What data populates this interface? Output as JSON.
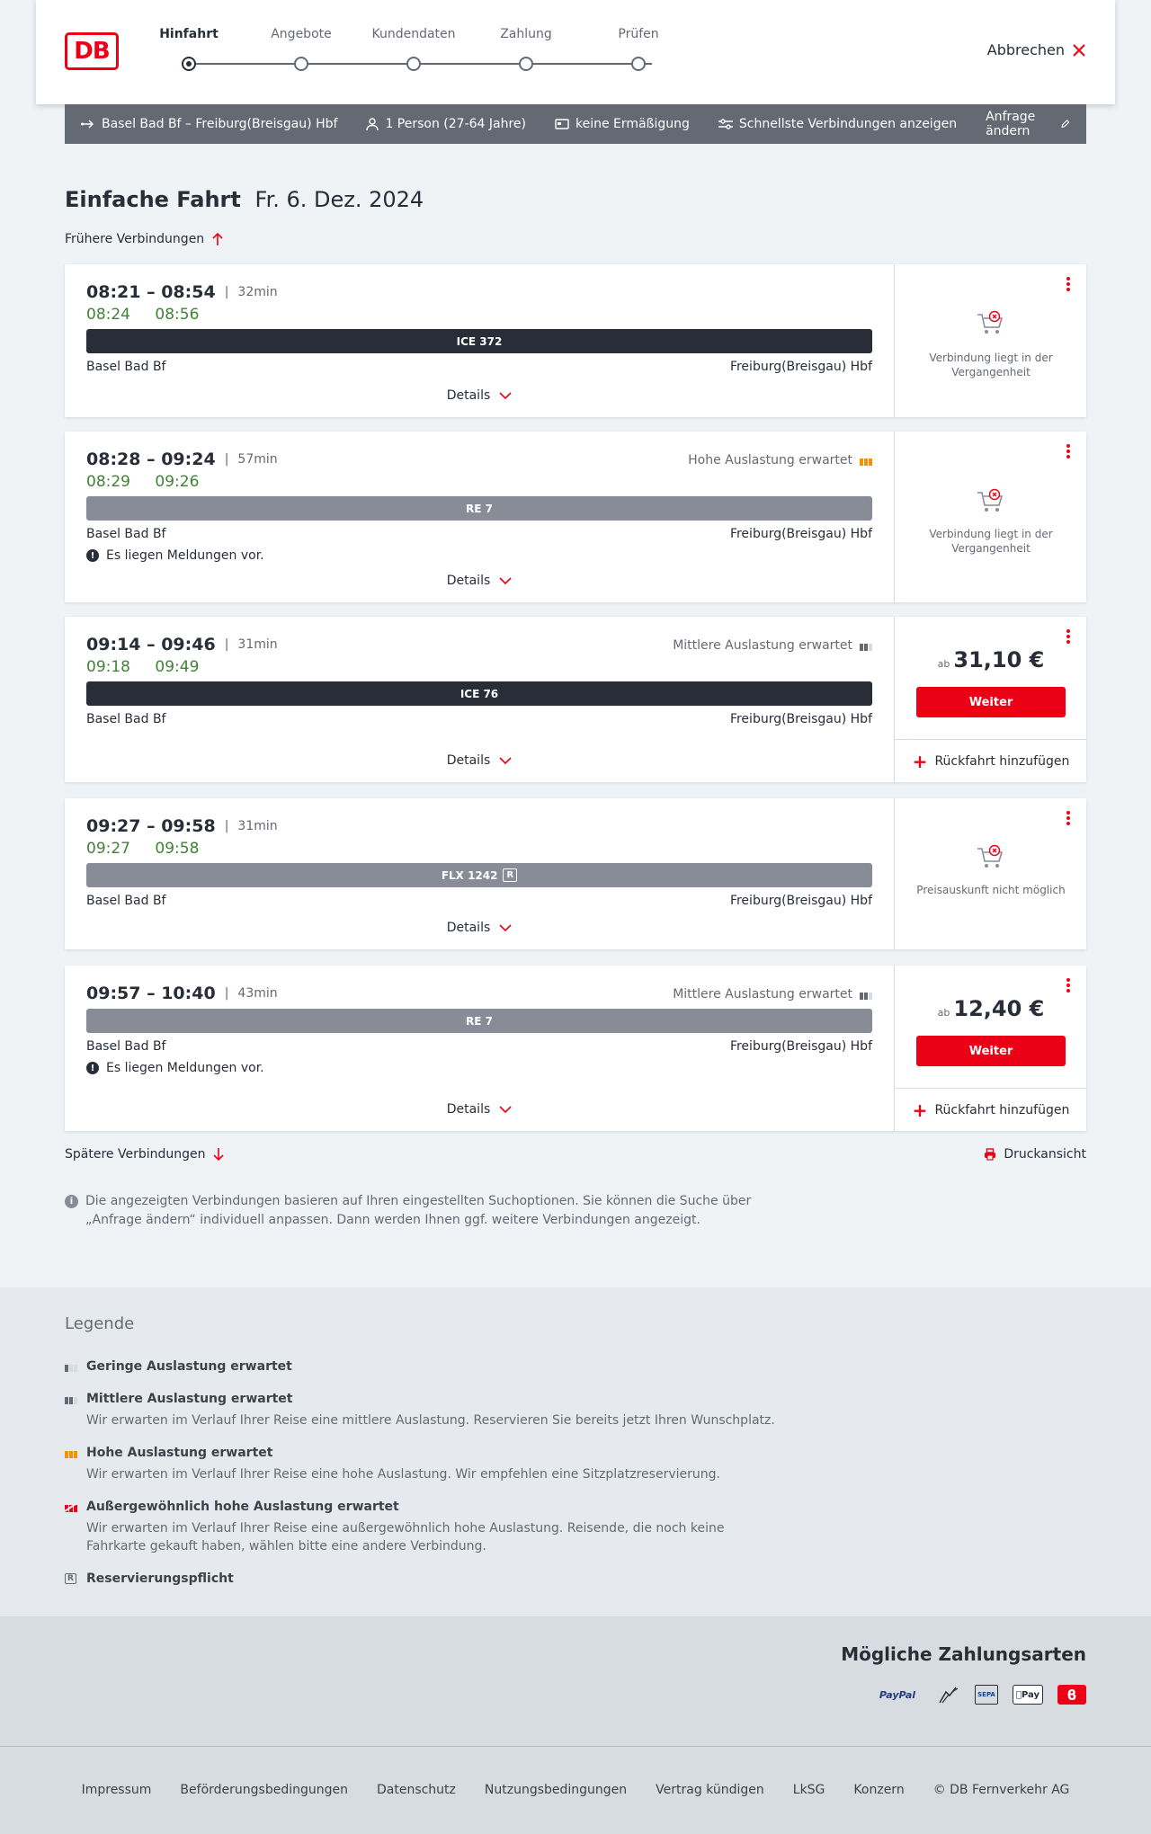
{
  "header": {
    "logo": "DB",
    "steps": [
      "Hinfahrt",
      "Angebote",
      "Kundendaten",
      "Zahlung",
      "Prüfen"
    ],
    "cancel": "Abbrechen"
  },
  "infobar": {
    "route": "Basel Bad Bf – Freiburg(Breisgau) Hbf",
    "persons": "1 Person (27-64 Jahre)",
    "discount": "keine Ermäßigung",
    "fastest": "Schnellste Verbindungen anzeigen",
    "edit": "Anfrage ändern"
  },
  "page": {
    "title": "Einfache Fahrt",
    "date": "Fr. 6. Dez. 2024",
    "earlier": "Frühere Verbindungen",
    "later": "Spätere Verbindungen",
    "print": "Druckansicht",
    "note": "Die angezeigten Verbindungen basieren auf Ihren eingestellten Suchoptionen. Sie können die Suche über „Anfrage ändern“ individuell anpassen. Dann werden Ihnen ggf. weitere Verbindungen angezeigt."
  },
  "connections": [
    {
      "times": "08:21 – 08:54",
      "sep": "|",
      "duration": "32min",
      "rt_dep": "08:24",
      "rt_arr": "08:56",
      "train": "ICE 372",
      "from": "Basel Bad Bf",
      "to": "Freiburg(Breisgau) Hbf",
      "details": "Details",
      "side_text": "Verbindung liegt in der Vergangenheit"
    },
    {
      "times": "08:28 – 09:24",
      "sep": "|",
      "duration": "57min",
      "rt_dep": "08:29",
      "rt_arr": "09:26",
      "train": "RE 7",
      "from": "Basel Bad Bf",
      "to": "Freiburg(Breisgau) Hbf",
      "message": "Es liegen Meldungen vor.",
      "load": "Hohe Auslastung erwartet",
      "details": "Details",
      "side_text": "Verbindung liegt in der Vergangenheit"
    },
    {
      "times": "09:14 – 09:46",
      "sep": "|",
      "duration": "31min",
      "rt_dep": "09:18",
      "rt_arr": "09:49",
      "train": "ICE 76",
      "from": "Basel Bad Bf",
      "to": "Freiburg(Breisgau) Hbf",
      "load": "Mittlere Auslastung erwartet",
      "details": "Details",
      "price_prefix": "ab",
      "price": "31,10 €",
      "button": "Weiter",
      "return": "Rückfahrt hinzufügen"
    },
    {
      "times": "09:27 – 09:58",
      "sep": "|",
      "duration": "31min",
      "rt_dep": "09:27",
      "rt_arr": "09:58",
      "train": "FLX 1242",
      "train_badge": "R",
      "from": "Basel Bad Bf",
      "to": "Freiburg(Breisgau) Hbf",
      "details": "Details",
      "side_text": "Preisauskunft nicht möglich"
    },
    {
      "times": "09:57 – 10:40",
      "sep": "|",
      "duration": "43min",
      "train": "RE 7",
      "from": "Basel Bad Bf",
      "to": "Freiburg(Breisgau) Hbf",
      "message": "Es liegen Meldungen vor.",
      "load": "Mittlere Auslastung erwartet",
      "details": "Details",
      "price_prefix": "ab",
      "price": "12,40 €",
      "button": "Weiter",
      "return": "Rückfahrt hinzufügen"
    }
  ],
  "legend": {
    "title": "Legende",
    "items": [
      {
        "title": "Geringe Auslastung erwartet",
        "desc": ""
      },
      {
        "title": "Mittlere Auslastung erwartet",
        "desc": "Wir erwarten im Verlauf Ihrer Reise eine mittlere Auslastung. Reservieren Sie bereits jetzt Ihren Wunschplatz."
      },
      {
        "title": "Hohe Auslastung erwartet",
        "desc": "Wir erwarten im Verlauf Ihrer Reise eine hohe Auslastung. Wir empfehlen eine Sitzplatzreservierung."
      },
      {
        "title": "Außergewöhnlich hohe Auslastung erwartet",
        "desc": "Wir erwarten im Verlauf Ihrer Reise eine außergewöhnlich hohe Auslastung. Reisende, die noch keine Fahrkarte gekauft haben, wählen bitte eine andere Verbindung."
      },
      {
        "title": "Reservierungspflicht",
        "desc": "",
        "badge": "R"
      }
    ]
  },
  "payment": {
    "title": "Mögliche Zahlungsarten",
    "paypal": "PayPal",
    "sepa": "SEPA",
    "applepay": "Pay"
  },
  "footer": {
    "links": [
      "Impressum",
      "Beförderungsbedingungen",
      "Datenschutz",
      "Nutzungsbedingungen",
      "Vertrag kündigen",
      "LkSG",
      "Konzern",
      "© DB Fernverkehr AG"
    ]
  },
  "colors": {
    "brand": "#ec0016",
    "realtime": "#408335",
    "dark": "#282d37",
    "grey": "#878c96",
    "high_load": "#f39200"
  }
}
